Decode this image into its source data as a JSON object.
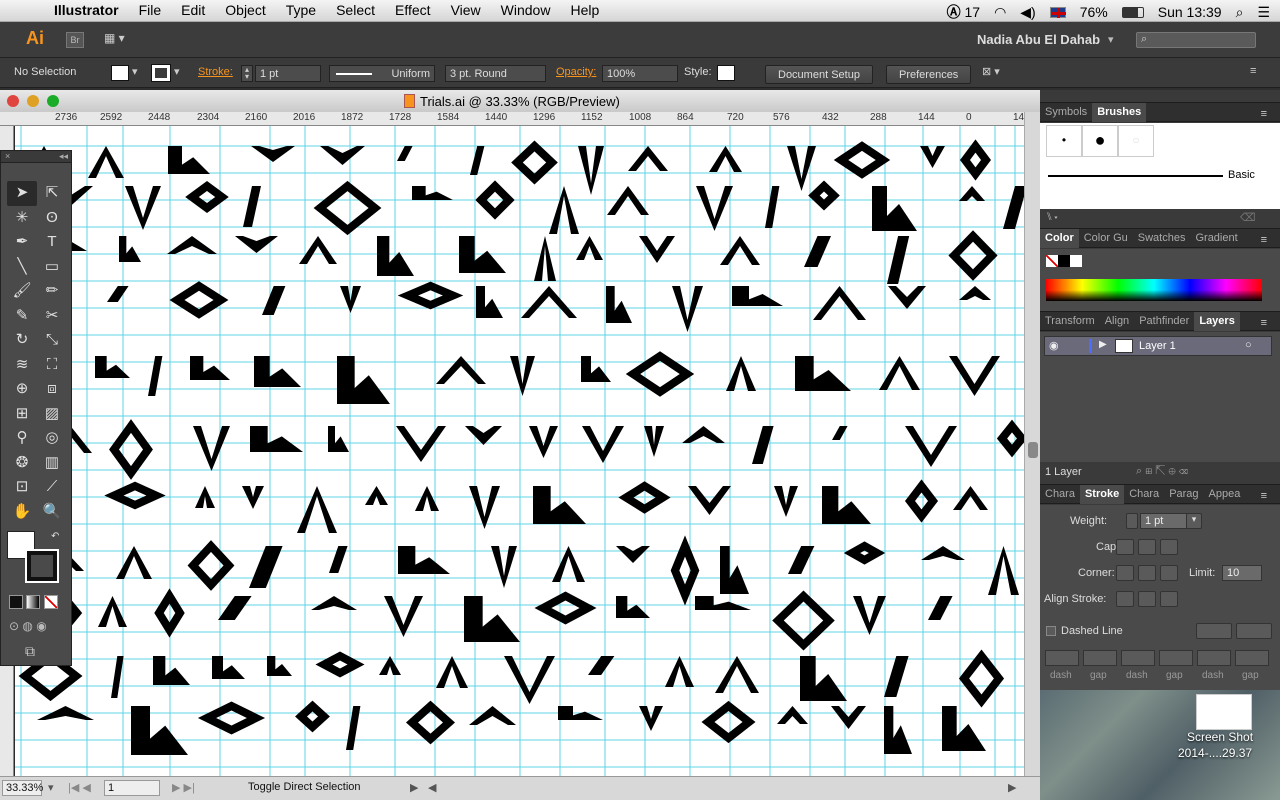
{
  "menubar": {
    "apple": "",
    "app": "Illustrator",
    "items": [
      "File",
      "Edit",
      "Object",
      "Type",
      "Select",
      "Effect",
      "View",
      "Window",
      "Help"
    ],
    "status": {
      "adobe": "17",
      "battery": "76%",
      "clock": "Sun 13:39"
    }
  },
  "appbar": {
    "logo": "Ai",
    "bridge": "Br",
    "user": "Nadia Abu El Dahab"
  },
  "control": {
    "selection": "No Selection",
    "stroke_label": "Stroke:",
    "stroke_weight": "1 pt",
    "profile": "Uniform",
    "brush": "3 pt. Round",
    "opacity_label": "Opacity:",
    "opacity": "100%",
    "style_label": "Style:",
    "doc_setup": "Document Setup",
    "preferences": "Preferences"
  },
  "document": {
    "title": "Trials.ai @ 33.33% (RGB/Preview)",
    "ruler_ticks": [
      "2736",
      "2592",
      "2448",
      "2304",
      "2160",
      "2016",
      "1872",
      "1728",
      "1584",
      "1440",
      "1296",
      "1152",
      "1008",
      "864",
      "720",
      "576",
      "432",
      "288",
      "144",
      "0",
      "14"
    ],
    "zoom": "33.33%",
    "artboard": "1",
    "status_text": "Toggle Direct Selection"
  },
  "panels": {
    "top_tabs": [
      "Symbols",
      "Brushes"
    ],
    "brush_label": "Basic",
    "color_tabs": [
      "Color",
      "Color Gu",
      "Swatches",
      "Gradient"
    ],
    "layer_tabs": [
      "Transform",
      "Align",
      "Pathfinder",
      "Layers"
    ],
    "layer_name": "Layer 1",
    "layer_count": "1 Layer",
    "stroke_tabs": [
      "Chara",
      "Stroke",
      "Chara",
      "Parag",
      "Appea"
    ],
    "stroke": {
      "weight_label": "Weight:",
      "weight": "1 pt",
      "cap_label": "Cap:",
      "corner_label": "Corner:",
      "limit_label": "Limit:",
      "limit": "10",
      "align_label": "Align Stroke:",
      "dashed": "Dashed Line",
      "dash_labels": [
        "dash",
        "gap",
        "dash",
        "gap",
        "dash",
        "gap"
      ]
    }
  },
  "desktop": {
    "caption1": "Screen Shot",
    "caption2": "2014-....29.37"
  }
}
